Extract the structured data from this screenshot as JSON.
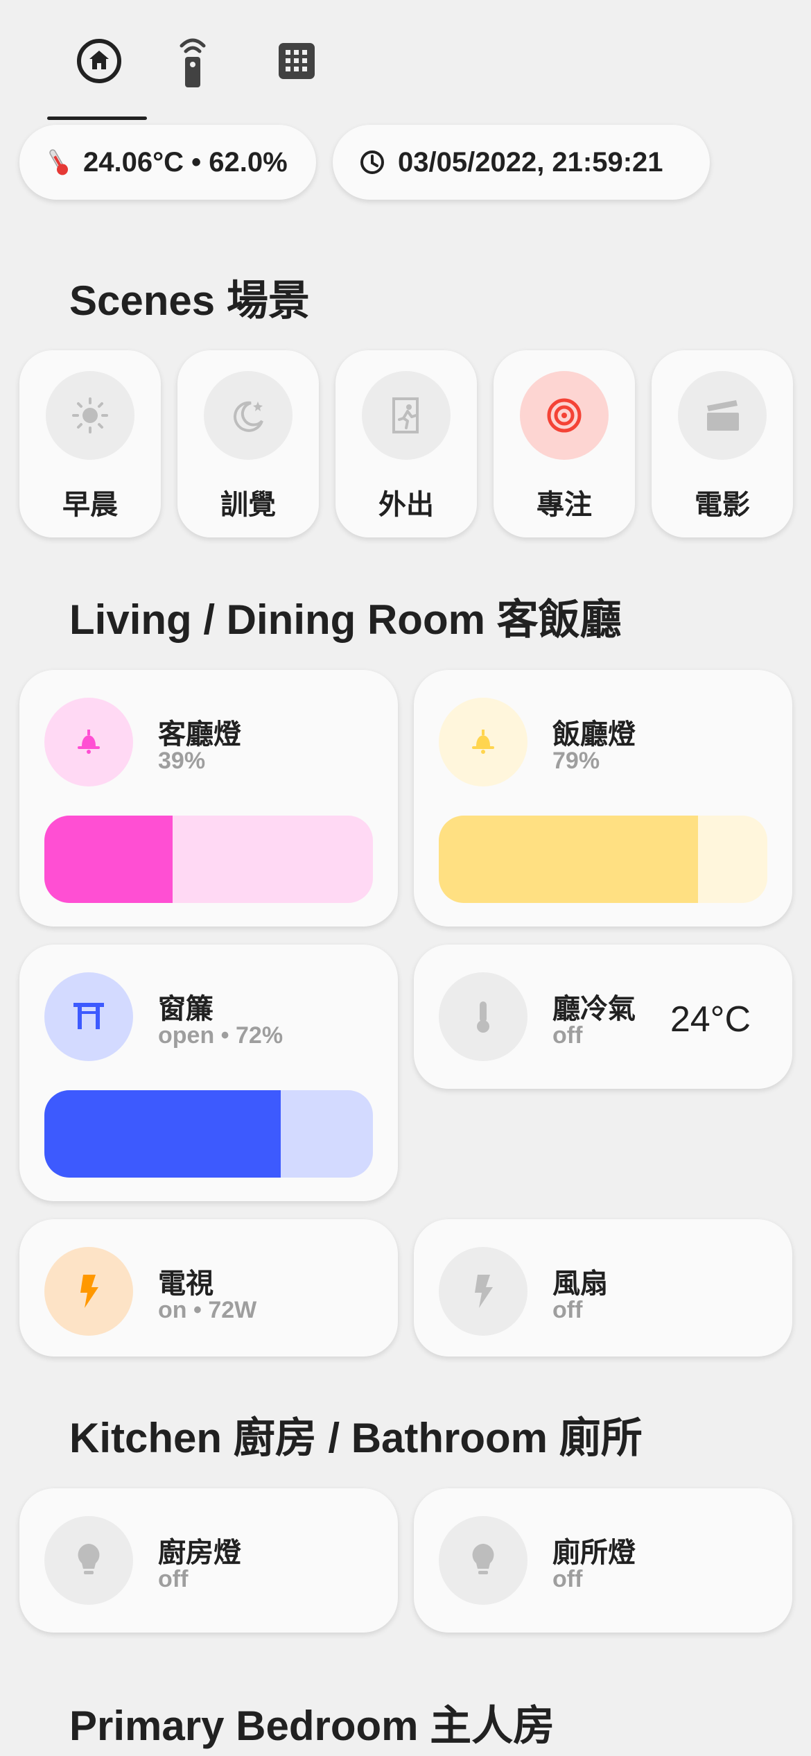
{
  "tabs": [
    {
      "name": "home-icon",
      "active": true
    },
    {
      "name": "remote-icon",
      "active": false
    },
    {
      "name": "grid-icon",
      "active": false
    }
  ],
  "chips": {
    "climate": "24.06°C • 62.0%",
    "datetime": "03/05/2022, 21:59:21"
  },
  "sections": {
    "scenes": "Scenes 場景",
    "living": "Living / Dining Room 客飯廳",
    "kitchen": "Kitchen 廚房 / Bathroom 廁所",
    "bedroom": "Primary Bedroom 主人房"
  },
  "scenes": [
    {
      "label": "早晨",
      "icon": "sun-icon",
      "active": false
    },
    {
      "label": "訓覺",
      "icon": "moon-icon",
      "active": false
    },
    {
      "label": "外出",
      "icon": "exit-icon",
      "active": false
    },
    {
      "label": "專注",
      "icon": "target-icon",
      "active": true
    },
    {
      "label": "電影",
      "icon": "clapperboard-icon",
      "active": false
    }
  ],
  "devices": {
    "living_light": {
      "name": "客廳燈",
      "state": "39%",
      "level": 39,
      "icon": "ceiling-light-icon"
    },
    "dining_light": {
      "name": "飯廳燈",
      "state": "79%",
      "level": 79,
      "icon": "ceiling-light-icon"
    },
    "curtain": {
      "name": "窗簾",
      "state": "open • 72%",
      "level": 72,
      "icon": "curtain-icon"
    },
    "aircon": {
      "name": "廳冷氣",
      "state": "off",
      "temp": "24°C",
      "icon": "thermometer-icon"
    },
    "tv": {
      "name": "電視",
      "state": "on • 72W",
      "icon": "power-icon"
    },
    "fan": {
      "name": "風扇",
      "state": "off",
      "icon": "power-icon"
    },
    "kitchen_light": {
      "name": "廚房燈",
      "state": "off",
      "icon": "bulb-icon"
    },
    "bath_light": {
      "name": "廁所燈",
      "state": "off",
      "icon": "bulb-icon"
    }
  },
  "colors": {
    "pink": "#ff4fd3",
    "pink_light": "#ffd9f4",
    "yellow": "#ffe082",
    "yellow_light": "#fff6dc",
    "blue": "#3d5afe",
    "blue_light": "#d3daff",
    "orange": "#ff9800",
    "red": "#f44336",
    "inactive": "#bdbdbd"
  }
}
